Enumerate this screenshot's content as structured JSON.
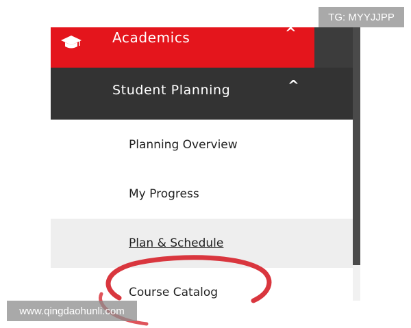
{
  "nav": {
    "academics": {
      "label": "Academics",
      "icon": "graduation-cap-icon",
      "expanded_glyph": "^"
    },
    "student_planning": {
      "label": "Student Planning",
      "expanded_glyph": "^"
    },
    "items": [
      {
        "label": "Planning Overview"
      },
      {
        "label": "My Progress"
      },
      {
        "label": "Plan & Schedule"
      },
      {
        "label": "Course Catalog"
      }
    ]
  },
  "colors": {
    "accent": "#e4151c",
    "header_dark": "#333333",
    "hover_row": "#eeeeee",
    "annotation": "#d9363e"
  },
  "watermarks": {
    "top_right": "TG: MYYJJPP",
    "bottom_left": "www.qingdaohunli.com"
  }
}
